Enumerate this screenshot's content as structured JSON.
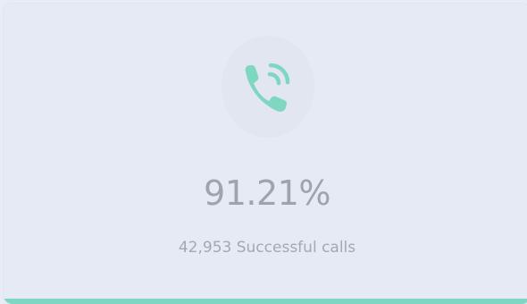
{
  "stat_card": {
    "icon": "phone-call-icon",
    "value": "91.21%",
    "label": "42,953 Successful calls",
    "progress": 0.9121,
    "colors": {
      "accent": "#7fd6c1",
      "background": "#e5eaf5",
      "text": "#9ea3ae"
    }
  }
}
